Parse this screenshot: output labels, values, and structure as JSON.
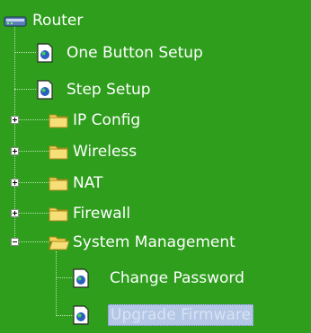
{
  "tree": {
    "root": {
      "label": "Router",
      "icon": "router-icon"
    },
    "items": [
      {
        "label": "One Button Setup",
        "type": "page",
        "icon": "page-icon"
      },
      {
        "label": "Step Setup",
        "type": "page",
        "icon": "page-icon"
      },
      {
        "label": "IP Config",
        "type": "folder",
        "state": "collapsed",
        "icon": "folder-icon"
      },
      {
        "label": "Wireless",
        "type": "folder",
        "state": "collapsed",
        "icon": "folder-icon"
      },
      {
        "label": "NAT",
        "type": "folder",
        "state": "collapsed",
        "icon": "folder-icon"
      },
      {
        "label": "Firewall",
        "type": "folder",
        "state": "collapsed",
        "icon": "folder-icon"
      },
      {
        "label": "System Management",
        "type": "folder",
        "state": "expanded",
        "icon": "open-folder-icon"
      },
      {
        "label": "Change Password",
        "type": "page",
        "icon": "page-icon"
      },
      {
        "label": "Upgrade Firmware",
        "type": "page",
        "icon": "page-icon",
        "selected": true
      }
    ]
  },
  "colors": {
    "background": "#2e9e1c",
    "text": "#ffffff",
    "selection": "#b4c7e6"
  }
}
